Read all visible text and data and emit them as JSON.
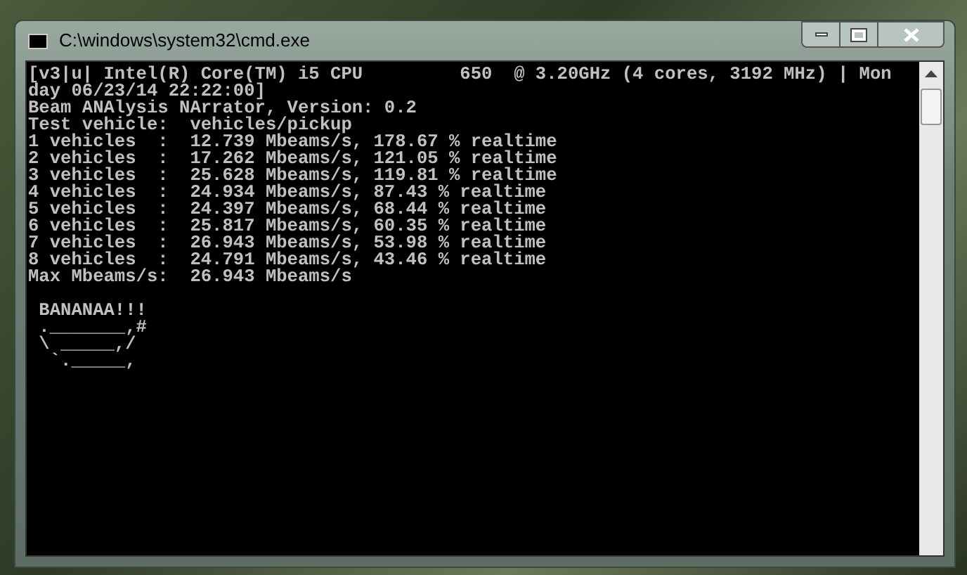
{
  "window": {
    "title": "C:\\windows\\system32\\cmd.exe"
  },
  "console": {
    "lines": [
      "[v3|u| Intel(R) Core(TM) i5 CPU         650  @ 3.20GHz (4 cores, 3192 MHz) | Mon",
      "day 06/23/14 22:22:00]",
      "Beam ANAlysis NArrator, Version: 0.2",
      "Test vehicle:  vehicles/pickup",
      "1 vehicles  :  12.739 Mbeams/s, 178.67 % realtime",
      "2 vehicles  :  17.262 Mbeams/s, 121.05 % realtime",
      "3 vehicles  :  25.628 Mbeams/s, 119.81 % realtime",
      "4 vehicles  :  24.934 Mbeams/s, 87.43 % realtime",
      "5 vehicles  :  24.397 Mbeams/s, 68.44 % realtime",
      "6 vehicles  :  25.817 Mbeams/s, 60.35 % realtime",
      "7 vehicles  :  26.943 Mbeams/s, 53.98 % realtime",
      "8 vehicles  :  24.791 Mbeams/s, 43.46 % realtime",
      "Max Mbeams/s:  26.943 Mbeams/s"
    ],
    "art": [
      " BANANAA!!!",
      " ._______,#",
      " \\ _____,/",
      "  `._____,"
    ]
  }
}
